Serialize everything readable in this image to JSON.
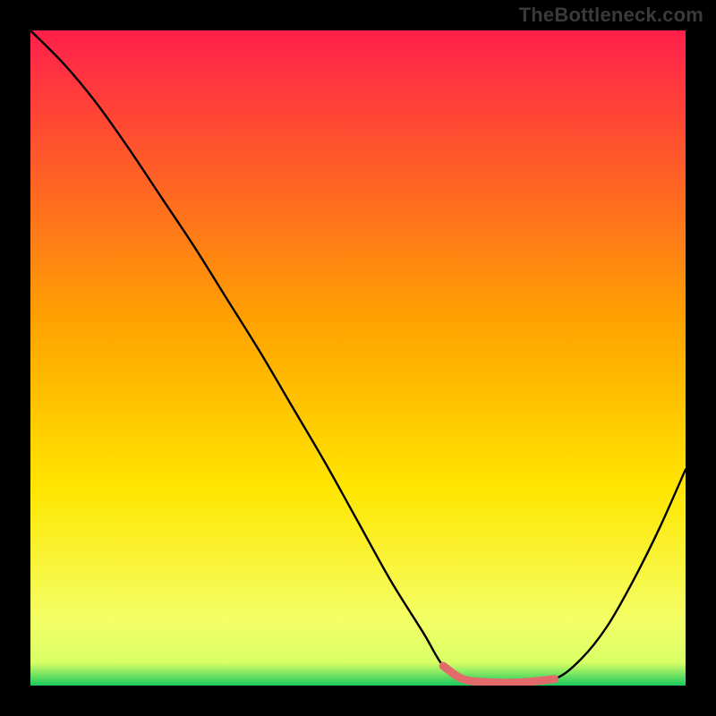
{
  "brand": {
    "watermark": "TheBottleneck.com"
  },
  "chart_data": {
    "type": "line",
    "title": "",
    "xlabel": "",
    "ylabel": "",
    "xlim": [
      0,
      100
    ],
    "ylim": [
      0,
      100
    ],
    "grid": false,
    "legend": false,
    "gradient_stops": [
      {
        "offset": 0.0,
        "color": "#ff1f4b"
      },
      {
        "offset": 0.45,
        "color": "#ffa400"
      },
      {
        "offset": 0.7,
        "color": "#ffe600"
      },
      {
        "offset": 0.9,
        "color": "#f4ff66"
      },
      {
        "offset": 0.965,
        "color": "#d9ff66"
      },
      {
        "offset": 1.0,
        "color": "#18c95d"
      }
    ],
    "series": [
      {
        "name": "bottleneck-curve",
        "color": "#000000",
        "x": [
          0,
          5,
          10,
          15,
          20,
          25,
          30,
          35,
          40,
          45,
          50,
          55,
          60,
          63,
          66,
          70,
          75,
          80,
          84,
          88,
          92,
          96,
          100
        ],
        "values": [
          100,
          95,
          89,
          82,
          74.5,
          67,
          59,
          51,
          42.5,
          34,
          25,
          16,
          8,
          3,
          1,
          0.5,
          0.5,
          1,
          4,
          9,
          16,
          24,
          33
        ]
      }
    ],
    "highlight": {
      "name": "optimal-range",
      "color": "#e26a6a",
      "x": [
        63,
        66,
        70,
        75,
        80
      ],
      "values": [
        3,
        1,
        0.5,
        0.5,
        1
      ]
    }
  }
}
